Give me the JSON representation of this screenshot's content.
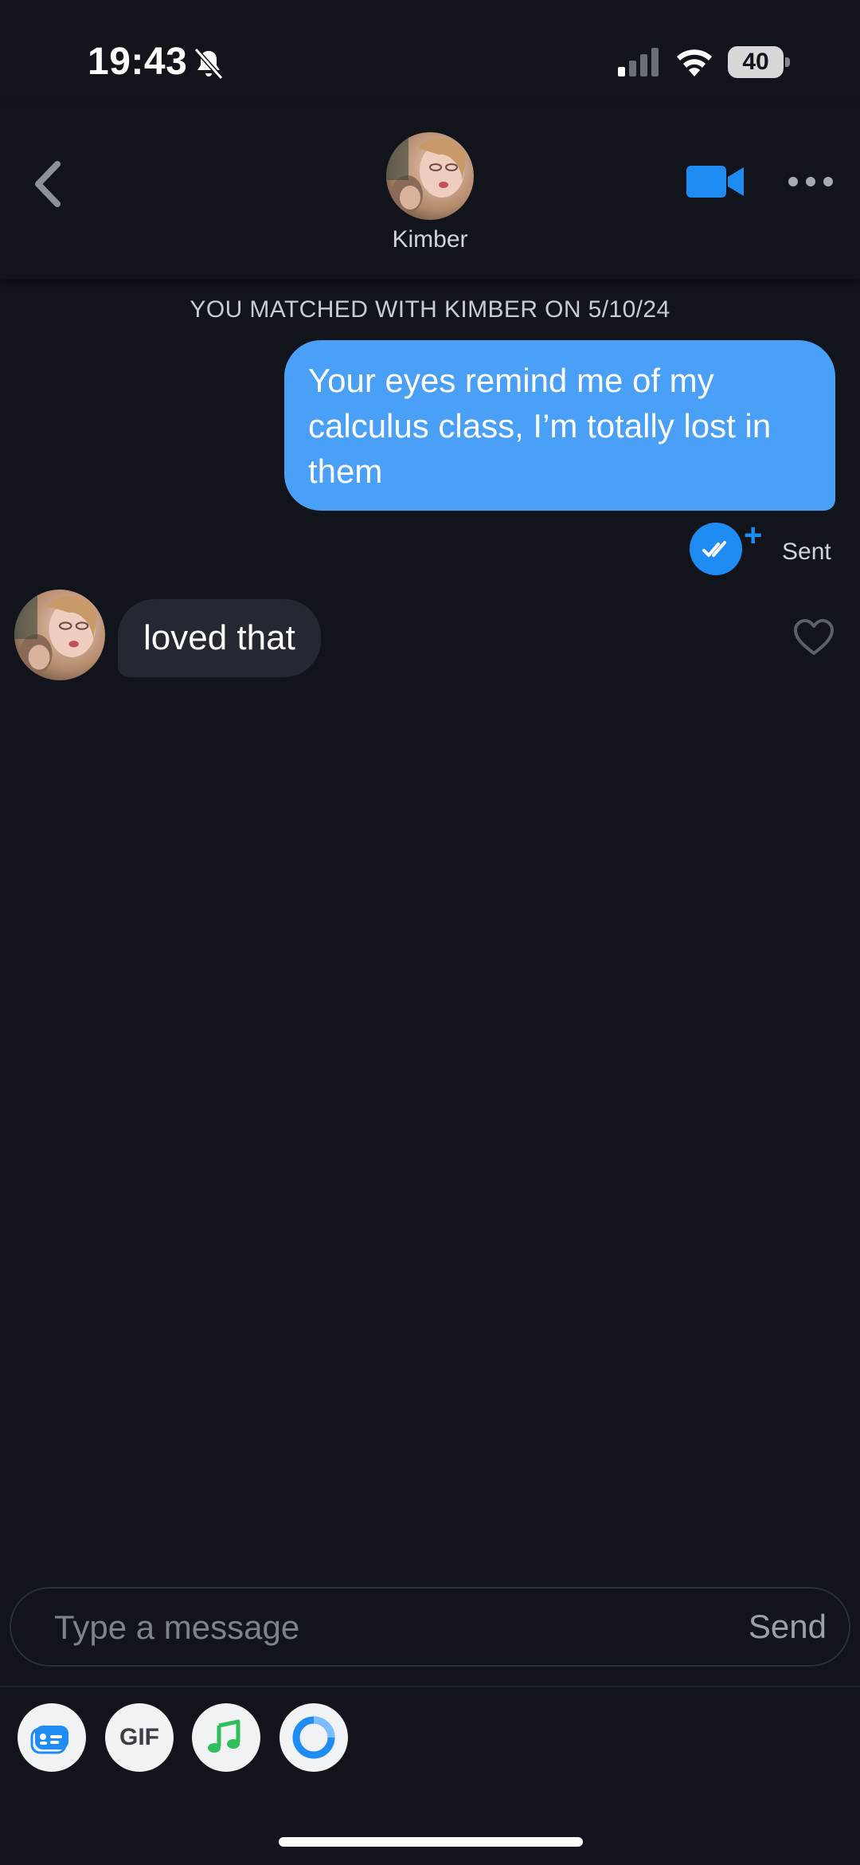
{
  "status_bar": {
    "time": "19:43",
    "battery": "40"
  },
  "header": {
    "match_name": "Kimber"
  },
  "conversation": {
    "matched_banner": "YOU MATCHED WITH KIMBER ON 5/10/24",
    "outgoing_message": "Your eyes remind me of my calculus class, I’m totally lost in them",
    "sent_status": "Sent",
    "plus_symbol": "+",
    "incoming_message": "loved that"
  },
  "composer": {
    "placeholder": "Type a message",
    "send_label": "Send"
  },
  "toolbar": {
    "gif_label": "GIF"
  },
  "colors": {
    "accent": "#1f8cf4",
    "bubble_out": "#4aa0f7",
    "background": "#11141b",
    "bubble_in": "#242830"
  },
  "icons": [
    "bell-muted-icon",
    "signal-icon",
    "wifi-icon",
    "back-chevron-icon",
    "video-call-icon",
    "more-icon",
    "double-check-icon",
    "heart-icon",
    "card-icon",
    "music-icon",
    "ring-icon"
  ]
}
